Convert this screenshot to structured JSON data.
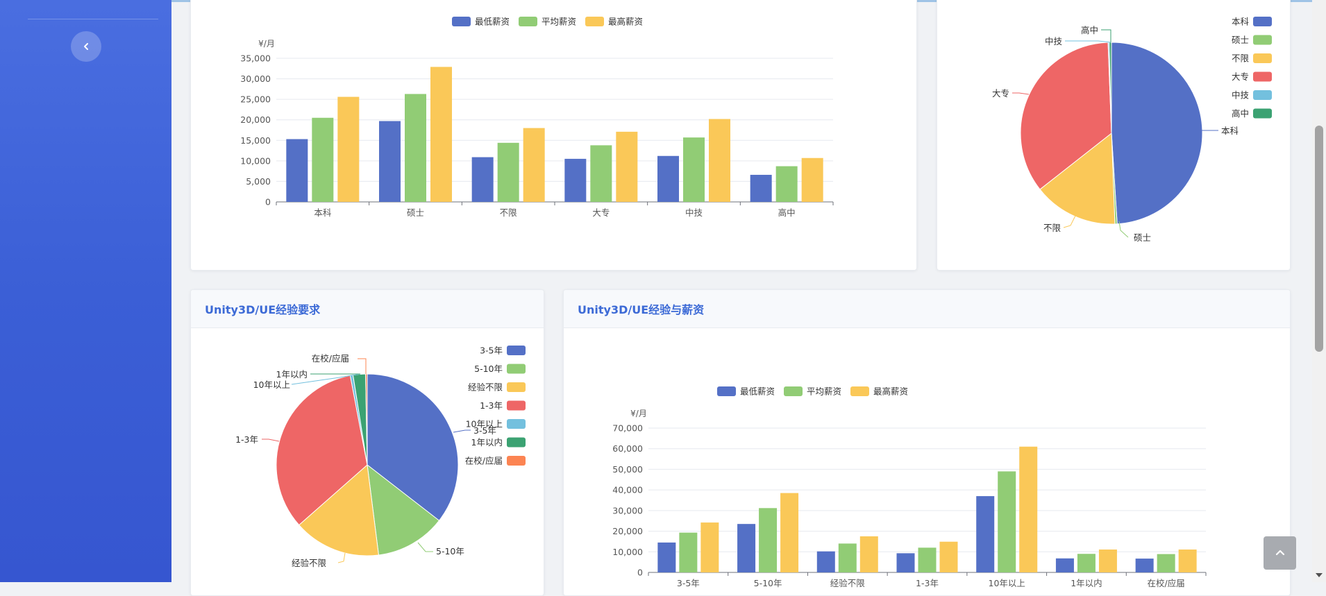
{
  "colors": {
    "blue": "#5470c6",
    "green": "#91cc75",
    "yellow": "#fac858",
    "red": "#ee6666",
    "cyan": "#73c0de",
    "teal": "#3ba272",
    "orange": "#fc8452"
  },
  "icons": {
    "collapse": "chevron-left-icon",
    "back_to_top": "chevron-up-icon",
    "scroll_down": "triangle-down-icon"
  },
  "cards": {
    "exp_pie": {
      "title": "Unity3D/UE经验要求"
    },
    "exp_bar": {
      "title": "Unity3D/UE经验与薪资"
    }
  },
  "chart_data": [
    {
      "id": "edu_salary",
      "type": "bar",
      "ylabel": "¥/月",
      "ylim": [
        0,
        35000
      ],
      "yticks": [
        "0",
        "5,000",
        "10,000",
        "15,000",
        "20,000",
        "25,000",
        "30,000",
        "35,000"
      ],
      "categories": [
        "本科",
        "硕士",
        "不限",
        "大专",
        "中技",
        "高中"
      ],
      "series": [
        {
          "name": "最低薪资",
          "color": "#5470c6",
          "values": [
            15300,
            19700,
            10900,
            10500,
            11200,
            6600
          ]
        },
        {
          "name": "平均薪资",
          "color": "#91cc75",
          "values": [
            20500,
            26300,
            14400,
            13800,
            15700,
            8700
          ]
        },
        {
          "name": "最高薪资",
          "color": "#fac858",
          "values": [
            25600,
            32900,
            18000,
            17100,
            20200,
            10700
          ]
        }
      ]
    },
    {
      "id": "edu_pie",
      "type": "pie",
      "legend_position": "right",
      "slices": [
        {
          "label": "本科",
          "value": 49.0,
          "color": "#5470c6"
        },
        {
          "label": "硕士",
          "value": 0.4,
          "color": "#91cc75"
        },
        {
          "label": "不限",
          "value": 15.0,
          "color": "#fac858"
        },
        {
          "label": "大专",
          "value": 35.0,
          "color": "#ee6666"
        },
        {
          "label": "中技",
          "value": 0.2,
          "color": "#73c0de"
        },
        {
          "label": "高中",
          "value": 0.4,
          "color": "#3ba272"
        }
      ]
    },
    {
      "id": "exp_pie",
      "type": "pie",
      "legend_position": "right",
      "slices": [
        {
          "label": "3-5年",
          "value": 35.5,
          "color": "#5470c6"
        },
        {
          "label": "5-10年",
          "value": 12.5,
          "color": "#91cc75"
        },
        {
          "label": "经验不限",
          "value": 15.5,
          "color": "#fac858"
        },
        {
          "label": "1-3年",
          "value": 33.5,
          "color": "#ee6666"
        },
        {
          "label": "10年以上",
          "value": 0.5,
          "color": "#73c0de"
        },
        {
          "label": "1年以内",
          "value": 2.2,
          "color": "#3ba272"
        },
        {
          "label": "在校/应届",
          "value": 0.3,
          "color": "#fc8452"
        }
      ]
    },
    {
      "id": "exp_salary",
      "type": "bar",
      "ylabel": "¥/月",
      "ylim": [
        0,
        70000
      ],
      "yticks": [
        "0",
        "10,000",
        "20,000",
        "30,000",
        "40,000",
        "50,000",
        "60,000",
        "70,000"
      ],
      "categories": [
        "3-5年",
        "5-10年",
        "经验不限",
        "1-3年",
        "10年以上",
        "1年以内",
        "在校/应届"
      ],
      "series": [
        {
          "name": "最低薪资",
          "color": "#5470c6",
          "values": [
            14500,
            23500,
            10200,
            9300,
            37000,
            6800,
            6700
          ]
        },
        {
          "name": "平均薪资",
          "color": "#91cc75",
          "values": [
            19300,
            31200,
            14000,
            12000,
            49000,
            9000,
            8900
          ]
        },
        {
          "name": "最高薪资",
          "color": "#fac858",
          "values": [
            24200,
            38500,
            17500,
            14900,
            61000,
            11100,
            11100
          ]
        }
      ]
    }
  ]
}
